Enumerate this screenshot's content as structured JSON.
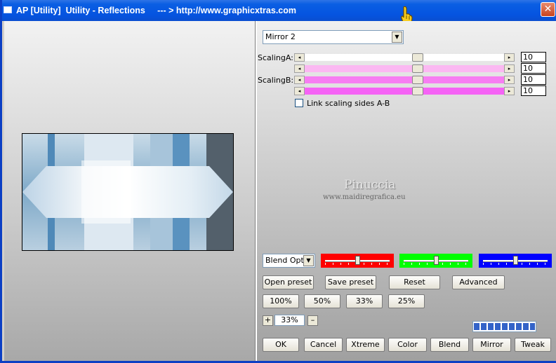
{
  "window": {
    "title": "AP [Utility]  Utility - Reflections     --- > http://www.graphicxtras.com",
    "close_symbol": "✕"
  },
  "mode": {
    "selected": "Mirror 2"
  },
  "sliders": {
    "scaling_a_label": "ScalingA:",
    "scaling_b_label": "ScalingB:",
    "arrow_left": "◂",
    "arrow_right": "▸",
    "rows": [
      {
        "value": "10",
        "position": 0.57,
        "color": "#ffffff"
      },
      {
        "value": "10",
        "position": 0.57,
        "color": "#fbb8f2"
      },
      {
        "value": "10",
        "position": 0.57,
        "color": "#f77df2"
      },
      {
        "value": "10",
        "position": 0.57,
        "color": "#f563f5"
      }
    ]
  },
  "link_checkbox": {
    "label": "Link scaling sides A-B",
    "checked": false
  },
  "watermark": {
    "name": "Pinuccia",
    "url": "www.maidiregrafica.eu"
  },
  "blend": {
    "selected": "Blend Optio"
  },
  "color_sliders": [
    {
      "color": "#ff0000",
      "position": 0.5
    },
    {
      "color": "#00ff00",
      "position": 0.5
    },
    {
      "color": "#0000ff",
      "position": 0.5
    }
  ],
  "buttons": {
    "open_preset": "Open preset",
    "save_preset": "Save preset",
    "reset": "Reset",
    "advanced": "Advanced",
    "zoom_100": "100%",
    "zoom_50": "50%",
    "zoom_33": "33%",
    "zoom_25": "25%",
    "ok": "OK",
    "cancel": "Cancel",
    "xtreme": "Xtreme",
    "color": "Color",
    "blend": "Blend",
    "mirror": "Mirror",
    "tweak": "Tweak"
  },
  "zoom": {
    "plus": "+",
    "minus": "–",
    "value": "33%"
  },
  "progress": {
    "fraction": 1.0
  }
}
